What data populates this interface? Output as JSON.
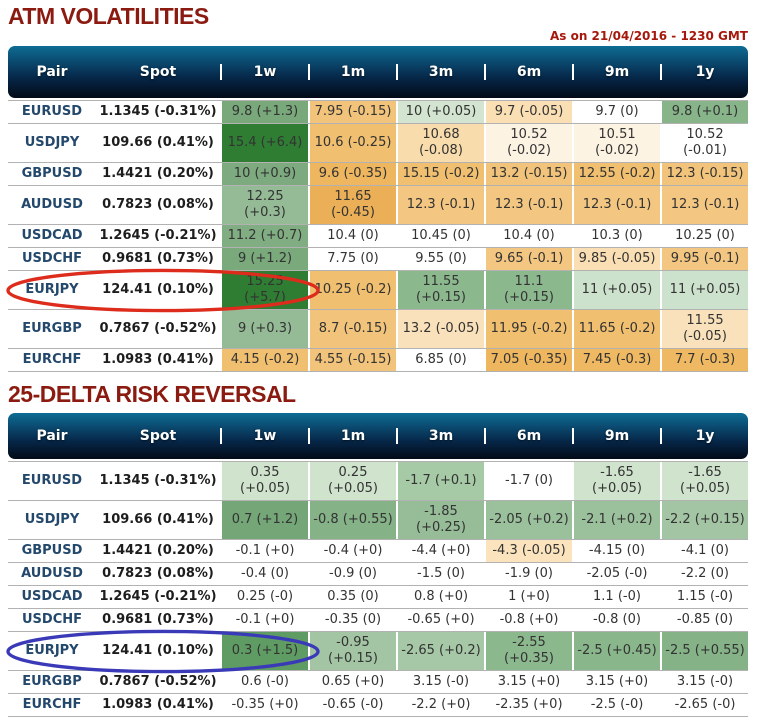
{
  "meta": {
    "timestamp": "As on 21/04/2016 - 1230 GMT"
  },
  "columns": [
    "Pair",
    "Spot",
    "1w",
    "1m",
    "3m",
    "6m",
    "9m",
    "1y"
  ],
  "colors": {
    "title": "#8b1a10",
    "timestamp": "#a6180c",
    "header_gradient_top": "#0c6c93",
    "header_gradient_bottom": "#020a16",
    "row_divider": "#b2b2b2",
    "pair_text": "#23486b",
    "positive_strong_green": "#2e7d32",
    "negative_orange": "#f0bf70",
    "annotation_red": "#dd2b1c",
    "annotation_blue": "#3a3ab8"
  },
  "tables": [
    {
      "title": "ATM VOLATILITIES",
      "rows": [
        {
          "pair": "EURUSD",
          "spot": "1.1345 (-0.31%)",
          "circle": null,
          "cells": [
            {
              "text": "9.8 (+1.3)",
              "bg": "#79a87b"
            },
            {
              "text": "7.95 (-0.15)",
              "bg": "#f2c47b"
            },
            {
              "text": "10 (+0.05)",
              "bg": "#d3e5d0"
            },
            {
              "text": "9.7 (-0.05)",
              "bg": "#f9dfb3"
            },
            {
              "text": "9.7 (0)",
              "bg": "#ffffff"
            },
            {
              "text": "9.8 (+0.1)",
              "bg": "#87b489"
            }
          ]
        },
        {
          "pair": "USDJPY",
          "spot": "109.66 (0.41%)",
          "circle": null,
          "cells": [
            {
              "text": "15.4 (+6.4)",
              "bg": "#2e7d32"
            },
            {
              "text": "10.6 (-0.25)",
              "bg": "#f0bf70"
            },
            {
              "text": "10.68\n(-0.08)",
              "bg": "#f8dcab"
            },
            {
              "text": "10.52\n(-0.02)",
              "bg": "#fdf3e2"
            },
            {
              "text": "10.51\n(-0.02)",
              "bg": "#fdf3e2"
            },
            {
              "text": "10.52\n(-0.01)",
              "bg": "#ffffff"
            }
          ]
        },
        {
          "pair": "GBPUSD",
          "spot": "1.4421 (0.20%)",
          "circle": null,
          "cells": [
            {
              "text": "10 (+0.9)",
              "bg": "#7dab7f"
            },
            {
              "text": "9.6 (-0.35)",
              "bg": "#edb65f"
            },
            {
              "text": "15.15 (-0.2)",
              "bg": "#f0bf70"
            },
            {
              "text": "13.2 (-0.15)",
              "bg": "#f2c47b"
            },
            {
              "text": "12.55 (-0.2)",
              "bg": "#f0bf70"
            },
            {
              "text": "12.3 (-0.15)",
              "bg": "#f2c47b"
            }
          ]
        },
        {
          "pair": "AUDUSD",
          "spot": "0.7823 (0.08%)",
          "circle": null,
          "cells": [
            {
              "text": "12.25\n(+0.3)",
              "bg": "#95bb96"
            },
            {
              "text": "11.65\n(-0.45)",
              "bg": "#ebb057"
            },
            {
              "text": "12.3 (-0.1)",
              "bg": "#f3c781"
            },
            {
              "text": "12.3 (-0.1)",
              "bg": "#f3c781"
            },
            {
              "text": "12.3 (-0.1)",
              "bg": "#f3c781"
            },
            {
              "text": "12.3 (-0.1)",
              "bg": "#f3c781"
            }
          ]
        },
        {
          "pair": "USDCAD",
          "spot": "1.2645 (-0.21%)",
          "circle": null,
          "cells": [
            {
              "text": "11.2 (+0.7)",
              "bg": "#80ad81"
            },
            {
              "text": "10.4 (0)",
              "bg": "#ffffff"
            },
            {
              "text": "10.45 (0)",
              "bg": "#ffffff"
            },
            {
              "text": "10.4 (0)",
              "bg": "#ffffff"
            },
            {
              "text": "10.3 (0)",
              "bg": "#ffffff"
            },
            {
              "text": "10.25 (0)",
              "bg": "#ffffff"
            }
          ]
        },
        {
          "pair": "USDCHF",
          "spot": "0.9681 (0.73%)",
          "circle": null,
          "cells": [
            {
              "text": "9 (+1.2)",
              "bg": "#7aa97c"
            },
            {
              "text": "7.75 (0)",
              "bg": "#ffffff"
            },
            {
              "text": "9.55 (0)",
              "bg": "#ffffff"
            },
            {
              "text": "9.65 (-0.1)",
              "bg": "#f3c781"
            },
            {
              "text": "9.85 (-0.05)",
              "bg": "#f9dfb3"
            },
            {
              "text": "9.95 (-0.1)",
              "bg": "#f3c781"
            }
          ]
        },
        {
          "pair": "EURJPY",
          "spot": "124.41 (0.10%)",
          "circle": "red",
          "cells": [
            {
              "text": "15.25\n(+5.7)",
              "bg": "#2e7d32"
            },
            {
              "text": "10.25 (-0.2)",
              "bg": "#f0bf70"
            },
            {
              "text": "11.55\n(+0.15)",
              "bg": "#8cb88e"
            },
            {
              "text": "11.1 (+0.15)",
              "bg": "#8cb88e"
            },
            {
              "text": "11 (+0.05)",
              "bg": "#cde2cd"
            },
            {
              "text": "11 (+0.05)",
              "bg": "#cde2cd"
            }
          ]
        },
        {
          "pair": "EURGBP",
          "spot": "0.7867 (-0.52%)",
          "circle": null,
          "cells": [
            {
              "text": "9 (+0.3)",
              "bg": "#95bb96"
            },
            {
              "text": "8.7 (-0.15)",
              "bg": "#f2c47b"
            },
            {
              "text": "13.2 (-0.05)",
              "bg": "#f9e2bb"
            },
            {
              "text": "11.95 (-0.2)",
              "bg": "#f0bf70"
            },
            {
              "text": "11.65 (-0.2)",
              "bg": "#f0bf70"
            },
            {
              "text": "11.55\n(-0.05)",
              "bg": "#f9e2bb"
            }
          ]
        },
        {
          "pair": "EURCHF",
          "spot": "1.0983 (0.41%)",
          "circle": null,
          "cells": [
            {
              "text": "4.15 (-0.2)",
              "bg": "#f0bf70"
            },
            {
              "text": "4.55 (-0.15)",
              "bg": "#f2c47b"
            },
            {
              "text": "6.85 (0)",
              "bg": "#ffffff"
            },
            {
              "text": "7.05 (-0.35)",
              "bg": "#edb65f"
            },
            {
              "text": "7.45 (-0.3)",
              "bg": "#eeb962"
            },
            {
              "text": "7.7 (-0.3)",
              "bg": "#eeb962"
            }
          ]
        }
      ]
    },
    {
      "title": "25-DELTA RISK REVERSAL",
      "rows": [
        {
          "pair": "EURUSD",
          "spot": "1.1345 (-0.31%)",
          "circle": null,
          "cells": [
            {
              "text": "0.35\n(+0.05)",
              "bg": "#cfe3cd"
            },
            {
              "text": "0.25 (+0.05)",
              "bg": "#cfe3cd"
            },
            {
              "text": "-1.7 (+0.1)",
              "bg": "#a6c9a6"
            },
            {
              "text": "-1.7 (0)",
              "bg": "#ffffff"
            },
            {
              "text": "-1.65\n(+0.05)",
              "bg": "#cfe3cd"
            },
            {
              "text": "-1.65\n(+0.05)",
              "bg": "#cfe3cd"
            }
          ]
        },
        {
          "pair": "USDJPY",
          "spot": "109.66 (0.41%)",
          "circle": null,
          "cells": [
            {
              "text": "0.7 (+1.2)",
              "bg": "#74a677"
            },
            {
              "text": "-0.8 (+0.55)",
              "bg": "#85b287"
            },
            {
              "text": "-1.85\n(+0.25)",
              "bg": "#97bd98"
            },
            {
              "text": "-2.05 (+0.2)",
              "bg": "#9bc09c"
            },
            {
              "text": "-2.1 (+0.2)",
              "bg": "#9bc09c"
            },
            {
              "text": "-2.2 (+0.15)",
              "bg": "#a3c5a4"
            }
          ]
        },
        {
          "pair": "GBPUSD",
          "spot": "1.4421 (0.20%)",
          "circle": null,
          "cells": [
            {
              "text": "-0.1 (+0)",
              "bg": "#ffffff"
            },
            {
              "text": "-0.4 (+0)",
              "bg": "#ffffff"
            },
            {
              "text": "-4.4 (+0)",
              "bg": "#ffffff"
            },
            {
              "text": "-4.3 (-0.05)",
              "bg": "#fae3bd"
            },
            {
              "text": "-4.15 (0)",
              "bg": "#ffffff"
            },
            {
              "text": "-4.1 (0)",
              "bg": "#ffffff"
            }
          ]
        },
        {
          "pair": "AUDUSD",
          "spot": "0.7823 (0.08%)",
          "circle": null,
          "cells": [
            {
              "text": "-0.4 (0)",
              "bg": "#ffffff"
            },
            {
              "text": "-0.9 (0)",
              "bg": "#ffffff"
            },
            {
              "text": "-1.5 (0)",
              "bg": "#ffffff"
            },
            {
              "text": "-1.9 (0)",
              "bg": "#ffffff"
            },
            {
              "text": "-2.05 (-0)",
              "bg": "#ffffff"
            },
            {
              "text": "-2.2 (0)",
              "bg": "#ffffff"
            }
          ]
        },
        {
          "pair": "USDCAD",
          "spot": "1.2645 (-0.21%)",
          "circle": null,
          "cells": [
            {
              "text": "0.25 (-0)",
              "bg": "#ffffff"
            },
            {
              "text": "0.35 (0)",
              "bg": "#ffffff"
            },
            {
              "text": "0.8 (+0)",
              "bg": "#ffffff"
            },
            {
              "text": "1 (+0)",
              "bg": "#ffffff"
            },
            {
              "text": "1.1 (-0)",
              "bg": "#ffffff"
            },
            {
              "text": "1.15 (-0)",
              "bg": "#ffffff"
            }
          ]
        },
        {
          "pair": "USDCHF",
          "spot": "0.9681 (0.73%)",
          "circle": null,
          "cells": [
            {
              "text": "-0.1 (+0)",
              "bg": "#ffffff"
            },
            {
              "text": "-0.35 (0)",
              "bg": "#ffffff"
            },
            {
              "text": "-0.65 (+0)",
              "bg": "#ffffff"
            },
            {
              "text": "-0.8 (+0)",
              "bg": "#ffffff"
            },
            {
              "text": "-0.8 (0)",
              "bg": "#ffffff"
            },
            {
              "text": "-0.85 (0)",
              "bg": "#ffffff"
            }
          ]
        },
        {
          "pair": "EURJPY",
          "spot": "124.41 (0.10%)",
          "circle": "blue",
          "cells": [
            {
              "text": "0.3 (+1.5)",
              "bg": "#5f9c63"
            },
            {
              "text": "-0.95\n(+0.15)",
              "bg": "#a3c5a4"
            },
            {
              "text": "-2.65 (+0.2)",
              "bg": "#a6c8a6"
            },
            {
              "text": "-2.55\n(+0.35)",
              "bg": "#8cb88e"
            },
            {
              "text": "-2.5 (+0.45)",
              "bg": "#89b68b"
            },
            {
              "text": "-2.5 (+0.55)",
              "bg": "#85b287"
            }
          ]
        },
        {
          "pair": "EURGBP",
          "spot": "0.7867 (-0.52%)",
          "circle": null,
          "cells": [
            {
              "text": "0.6 (-0)",
              "bg": "#ffffff"
            },
            {
              "text": "0.65 (+0)",
              "bg": "#ffffff"
            },
            {
              "text": "3.15 (-0)",
              "bg": "#ffffff"
            },
            {
              "text": "3.15 (+0)",
              "bg": "#ffffff"
            },
            {
              "text": "3.15 (+0)",
              "bg": "#ffffff"
            },
            {
              "text": "3.15 (-0)",
              "bg": "#ffffff"
            }
          ]
        },
        {
          "pair": "EURCHF",
          "spot": "1.0983 (0.41%)",
          "circle": null,
          "cells": [
            {
              "text": "-0.35 (+0)",
              "bg": "#ffffff"
            },
            {
              "text": "-0.65 (-0)",
              "bg": "#ffffff"
            },
            {
              "text": "-2.2 (+0)",
              "bg": "#ffffff"
            },
            {
              "text": "-2.35 (+0)",
              "bg": "#ffffff"
            },
            {
              "text": "-2.5 (-0)",
              "bg": "#ffffff"
            },
            {
              "text": "-2.65 (-0)",
              "bg": "#ffffff"
            }
          ]
        }
      ]
    }
  ]
}
